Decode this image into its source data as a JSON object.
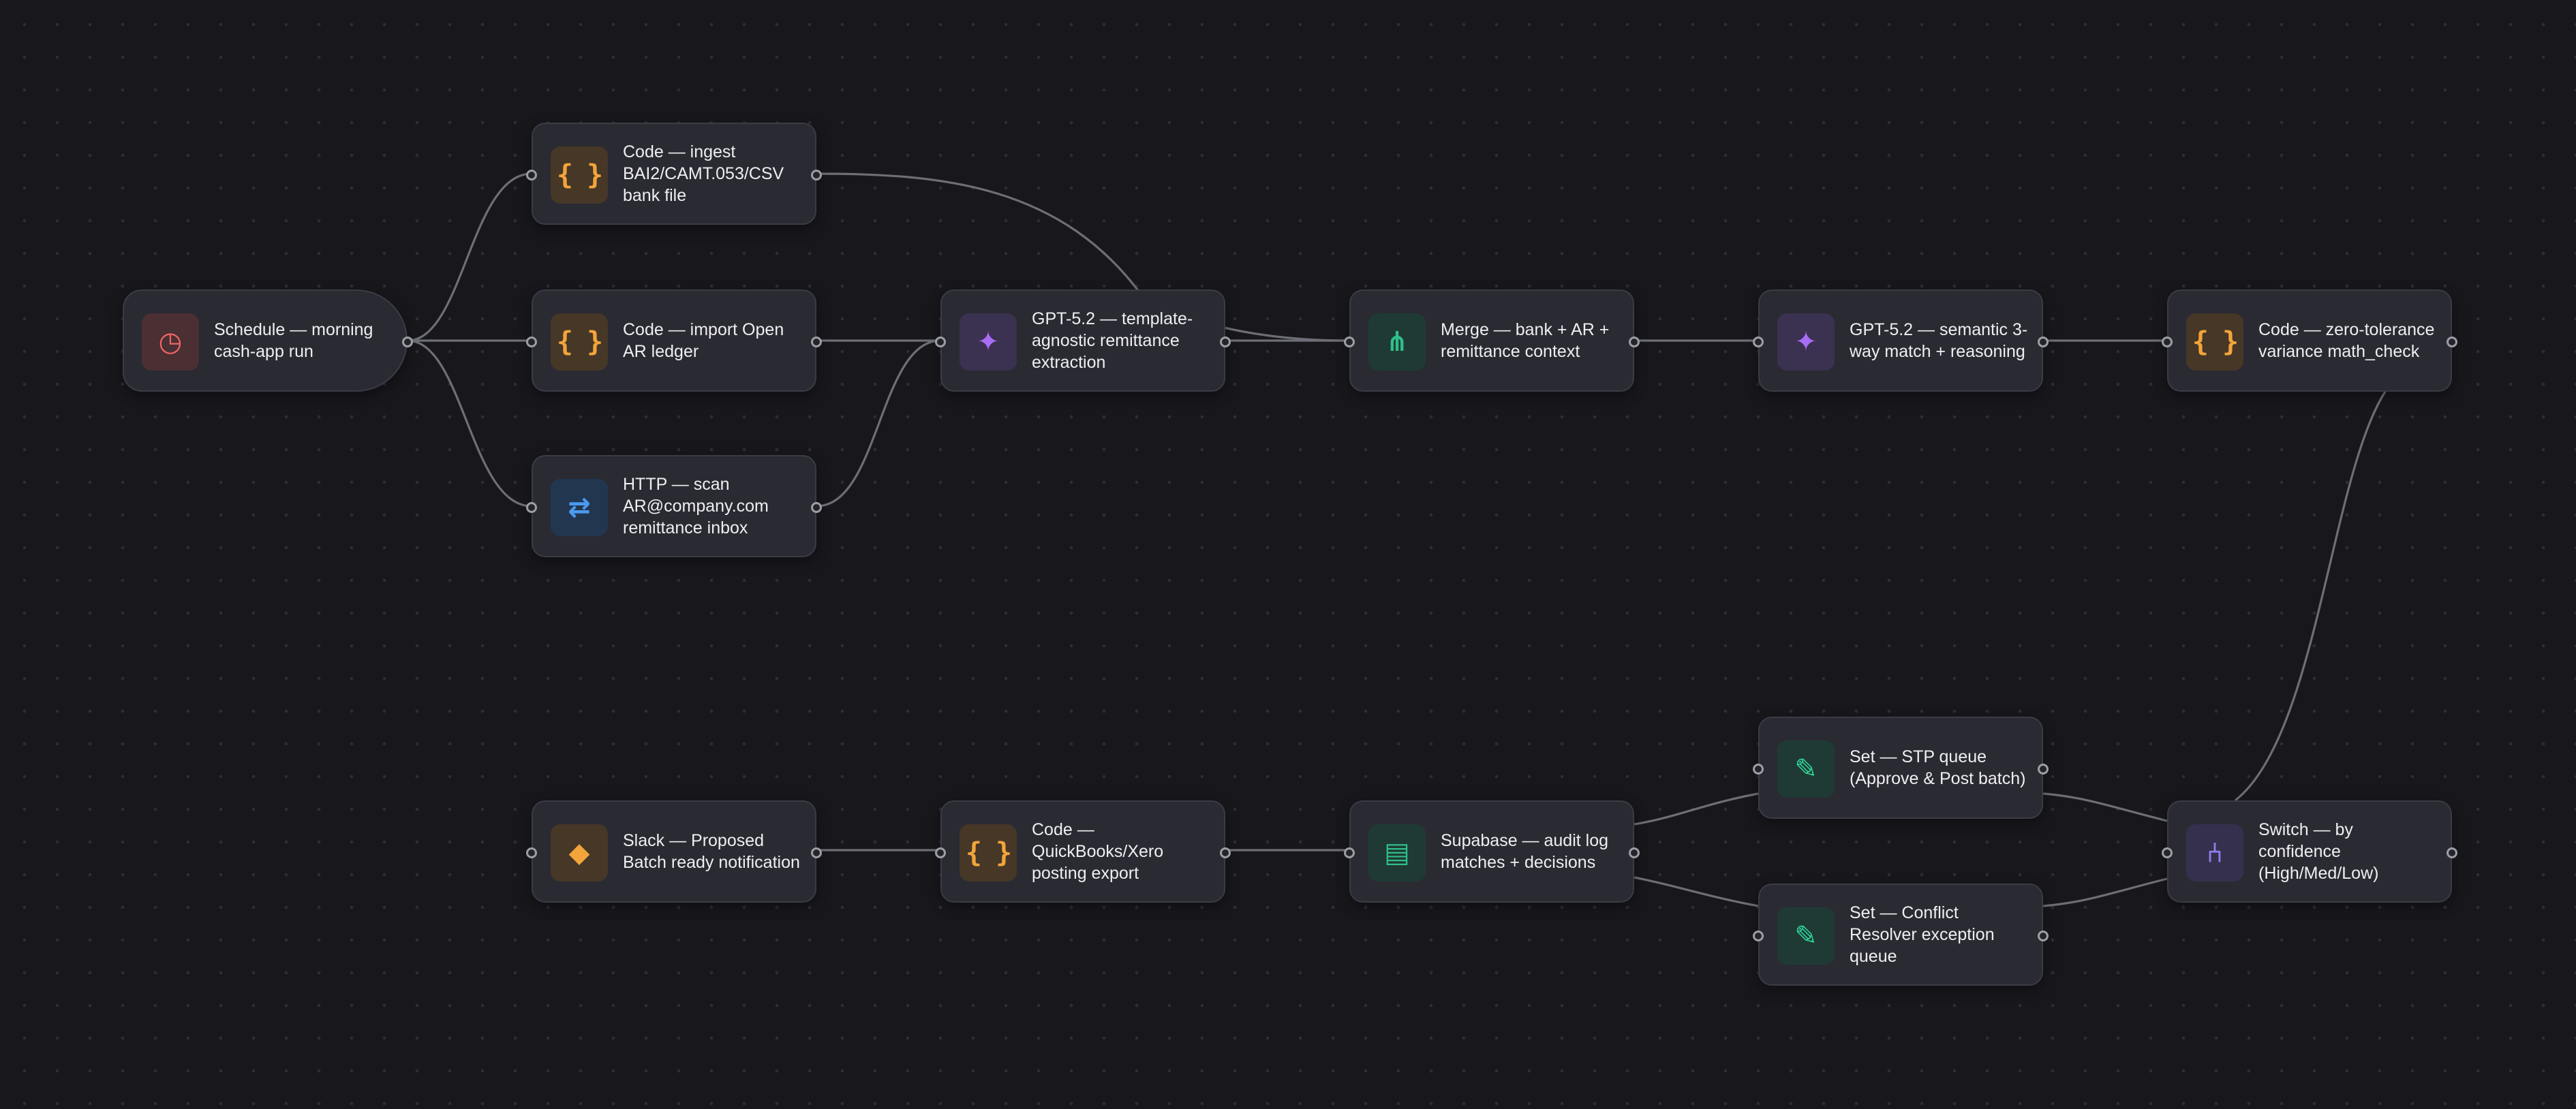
{
  "workflow": {
    "nodes": [
      {
        "id": "schedule",
        "label": "Schedule — morning cash-app run",
        "icon": "clock-icon",
        "kind": "schedule"
      },
      {
        "id": "ingest",
        "label": "Code — ingest BAI2/CAMT.053/CSV bank file",
        "icon": "code-braces-icon",
        "kind": "code"
      },
      {
        "id": "import",
        "label": "Code — import Open AR ledger",
        "icon": "code-braces-icon",
        "kind": "code"
      },
      {
        "id": "http",
        "label": "HTTP — scan AR@company.com remittance inbox",
        "icon": "http-arrows-icon",
        "kind": "http"
      },
      {
        "id": "extract",
        "label": "GPT-5.2 — template-agnostic remittance extraction",
        "icon": "sparkle-icon",
        "kind": "ai"
      },
      {
        "id": "merge",
        "label": "Merge — bank + AR + remittance context",
        "icon": "merge-icon",
        "kind": "merge"
      },
      {
        "id": "match",
        "label": "GPT-5.2 — semantic 3-way match + reasoning",
        "icon": "sparkle-icon",
        "kind": "ai"
      },
      {
        "id": "variance",
        "label": "Code — zero-tolerance variance math_check",
        "icon": "code-braces-icon",
        "kind": "code"
      },
      {
        "id": "switch",
        "label": "Switch — by confidence (High/Med/Low)",
        "icon": "switch-fork-icon",
        "kind": "switch"
      },
      {
        "id": "stp",
        "label": "Set — STP queue (Approve & Post batch)",
        "icon": "pencil-icon",
        "kind": "set"
      },
      {
        "id": "conflict",
        "label": "Set — Conflict Resolver exception queue",
        "icon": "pencil-icon",
        "kind": "set"
      },
      {
        "id": "supabase",
        "label": "Supabase — audit log matches + decisions",
        "icon": "table-icon",
        "kind": "db"
      },
      {
        "id": "export",
        "label": "Code — QuickBooks/Xero posting export",
        "icon": "code-braces-icon",
        "kind": "code"
      },
      {
        "id": "slack",
        "label": "Slack — Proposed Batch ready notification",
        "icon": "slack-diamond-icon",
        "kind": "slack"
      }
    ],
    "connections": [
      [
        "schedule",
        "ingest"
      ],
      [
        "schedule",
        "import"
      ],
      [
        "schedule",
        "http"
      ],
      [
        "ingest",
        "merge"
      ],
      [
        "import",
        "extract"
      ],
      [
        "http",
        "extract"
      ],
      [
        "extract",
        "merge"
      ],
      [
        "merge",
        "match"
      ],
      [
        "match",
        "variance"
      ],
      [
        "variance",
        "switch"
      ],
      [
        "switch",
        "stp"
      ],
      [
        "switch",
        "conflict"
      ],
      [
        "stp",
        "supabase"
      ],
      [
        "conflict",
        "supabase"
      ],
      [
        "supabase",
        "export"
      ],
      [
        "export",
        "slack"
      ]
    ]
  },
  "colors": {
    "canvas_background": "#17171c",
    "node_background": "#2a2a33",
    "edge": "#6e6e76",
    "code": "#f3a43a",
    "ai": "#a96cf5",
    "merge": "#2fbf8a",
    "schedule": "#ef6565",
    "http": "#4a9bf0",
    "switch": "#8f7de8"
  }
}
